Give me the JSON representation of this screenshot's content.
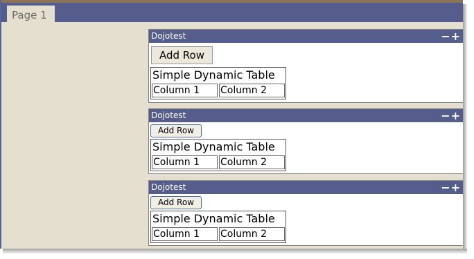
{
  "tabs": [
    {
      "label": "Page 1"
    }
  ],
  "portlets": [
    {
      "title": "Dojotest",
      "controls": "−+",
      "add_row_label": "Add Row",
      "table": {
        "caption": "Simple Dynamic Table",
        "columns": [
          "Column 1",
          "Column 2"
        ]
      }
    },
    {
      "title": "Dojotest",
      "controls": "−+",
      "add_row_label": "Add Row",
      "table": {
        "caption": "Simple Dynamic Table",
        "columns": [
          "Column 1",
          "Column 2"
        ]
      }
    },
    {
      "title": "Dojotest",
      "controls": "−+",
      "add_row_label": "Add Row",
      "table": {
        "caption": "Simple Dynamic Table",
        "columns": [
          "Column 1",
          "Column 2"
        ]
      }
    }
  ],
  "colors": {
    "header_bar": "#545d8c",
    "page_background": "#e5dfd0",
    "top_strip": "#8b7356"
  }
}
